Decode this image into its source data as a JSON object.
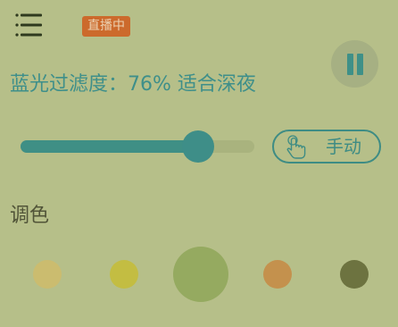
{
  "header": {
    "menu_icon": "list-menu-icon",
    "live_badge": {
      "text": "直播中",
      "bg_color": "#cc6a2c",
      "text_color": "#ecd2b2"
    },
    "pause_icon": "pause-icon"
  },
  "filter": {
    "label": "蓝光过滤度：",
    "value_text": "76%",
    "hint": "适合深夜",
    "level_percent": 76,
    "text_color": "#3e8f8a"
  },
  "mode_button": {
    "label": "手动",
    "icon": "hand-pointer-icon"
  },
  "palette": {
    "title": "调色",
    "swatches": [
      {
        "color": "#cbbc6f",
        "selected": false
      },
      {
        "color": "#c3bd42",
        "selected": false
      },
      {
        "color": "#95aa60",
        "selected": true
      },
      {
        "color": "#c4914d",
        "selected": false
      },
      {
        "color": "#6d7340",
        "selected": false
      }
    ]
  }
}
